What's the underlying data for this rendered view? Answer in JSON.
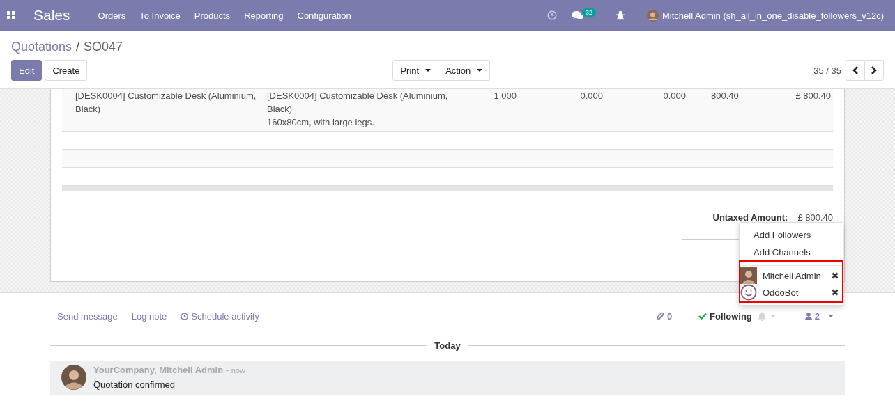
{
  "navbar": {
    "app": "Sales",
    "menu": [
      "Orders",
      "To Invoice",
      "Products",
      "Reporting",
      "Configuration"
    ],
    "message_count": "32",
    "user": "Mitchell Admin (sh_all_in_one_disable_followers_v12c)"
  },
  "breadcrumb": {
    "parent": "Quotations",
    "separator": "/",
    "current": "SO047"
  },
  "buttons": {
    "edit": "Edit",
    "create": "Create",
    "print": "Print",
    "action": "Action"
  },
  "pager": "35 / 35",
  "order_lines": [
    {
      "product": "[DESK0004] Customizable Desk (Aluminium, Black)",
      "description": [
        "[DESK0004] Customizable Desk (Aluminium, Black)",
        "160x80cm, with large legs."
      ],
      "quantity": "1.000",
      "column_4": "0.000",
      "column_5": "0.000",
      "unit_price": "800.40",
      "subtotal": "£ 800.40"
    }
  ],
  "totals": {
    "label": "Untaxed Amount:",
    "value": "£ 800.40"
  },
  "followers_menu": {
    "actions": [
      "Add Followers",
      "Add Channels"
    ],
    "followers": [
      {
        "name": "Mitchell Admin",
        "kind": "user"
      },
      {
        "name": "OdooBot",
        "kind": "bot"
      }
    ]
  },
  "chatter": {
    "actions": [
      "Send message",
      "Log note",
      "Schedule activity"
    ],
    "attachments": "0",
    "following": "Following",
    "followers_count": "2",
    "separator": "Today",
    "messages": [
      {
        "author": "YourCompany, Mitchell Admin",
        "dash": "-",
        "time": "now",
        "body": "Quotation confirmed"
      }
    ]
  }
}
